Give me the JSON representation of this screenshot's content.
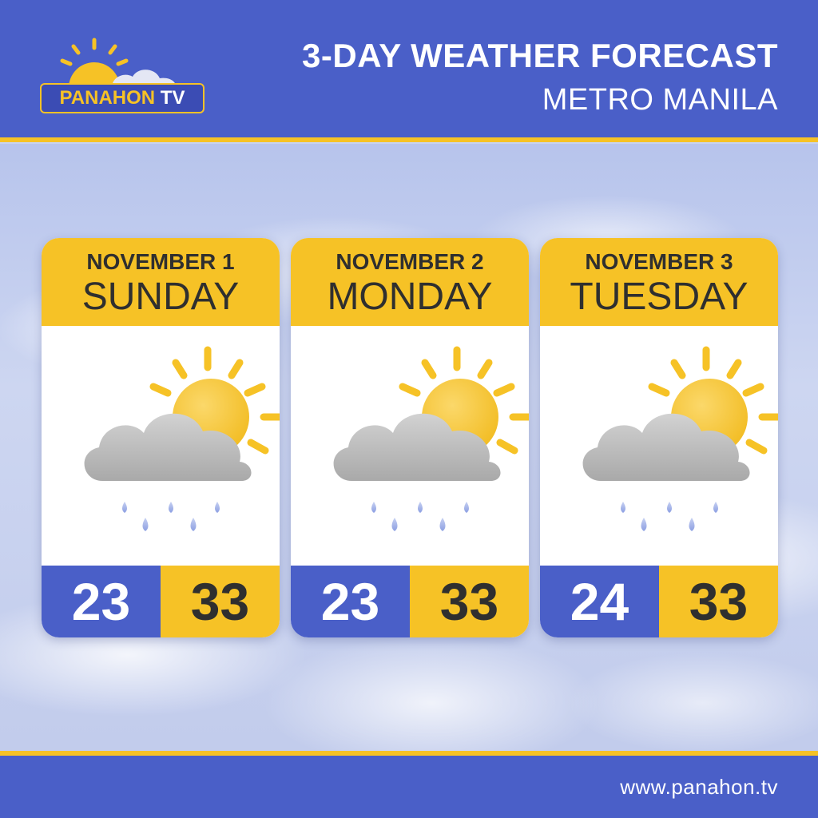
{
  "header": {
    "title": "3-DAY WEATHER FORECAST",
    "subtitle": "METRO MANILA"
  },
  "logo": {
    "brand": "PANAHON",
    "tv": "TV"
  },
  "colors": {
    "header_blue": "#4a5fc8",
    "accent_yellow": "#f6c226",
    "text_dark": "#2f2f2f"
  },
  "days": [
    {
      "date": "NOVEMBER 1",
      "day": "SUNDAY",
      "icon": "partly-sunny-rain-icon",
      "low": "23",
      "high": "33"
    },
    {
      "date": "NOVEMBER 2",
      "day": "MONDAY",
      "icon": "partly-sunny-rain-icon",
      "low": "23",
      "high": "33"
    },
    {
      "date": "NOVEMBER 3",
      "day": "TUESDAY",
      "icon": "partly-sunny-rain-icon",
      "low": "24",
      "high": "33"
    }
  ],
  "footer": {
    "url": "www.panahon.tv"
  }
}
